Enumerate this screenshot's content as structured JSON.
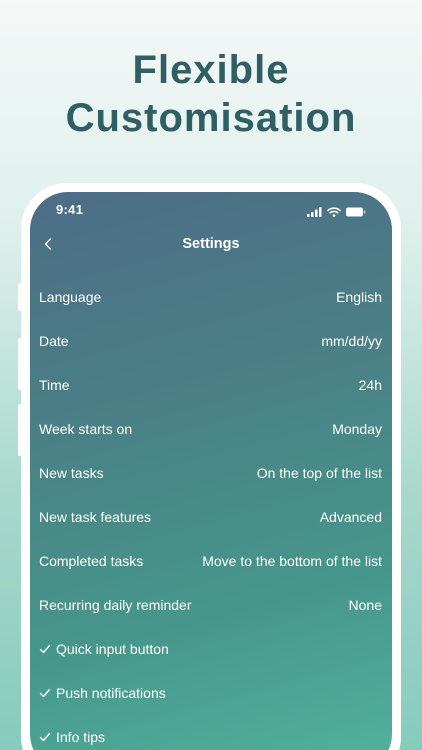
{
  "headline": {
    "line1": "Flexible",
    "line2": "Customisation"
  },
  "status_bar": {
    "time": "9:41"
  },
  "nav": {
    "title": "Settings"
  },
  "settings": [
    {
      "label": "Language",
      "value": "English"
    },
    {
      "label": "Date",
      "value": "mm/dd/yy"
    },
    {
      "label": "Time",
      "value": "24h"
    },
    {
      "label": "Week starts on",
      "value": "Monday"
    },
    {
      "label": "New tasks",
      "value": "On the top of the list"
    },
    {
      "label": "New task features",
      "value": "Advanced"
    },
    {
      "label": "Completed tasks",
      "value": "Move to the bottom of the list"
    },
    {
      "label": "Recurring daily reminder",
      "value": "None"
    }
  ],
  "toggles": [
    {
      "label": "Quick input button",
      "checked": true
    },
    {
      "label": "Push notifications",
      "checked": true
    },
    {
      "label": "Info tips",
      "checked": true
    }
  ],
  "icons": {
    "back": "chevron-left-icon",
    "check": "checkmark-icon",
    "signal": "signal-icon",
    "wifi": "wifi-icon",
    "battery": "battery-icon"
  },
  "colors": {
    "headline": "#2f5e63",
    "screen_top": "#4d6d86",
    "screen_bottom": "#52b39d",
    "page_background_bottom": "#86cbbb"
  }
}
